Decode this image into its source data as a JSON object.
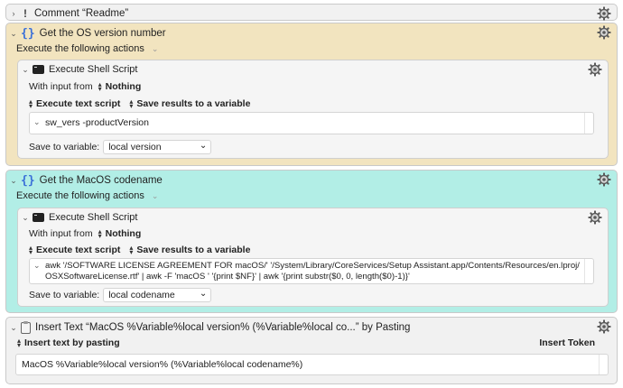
{
  "colors": {
    "accent_blue": "#3a6fd8",
    "yellow_group": "#f2e4bf",
    "teal_group": "#b2eee6"
  },
  "comment": {
    "title": "Comment “Readme”",
    "icon": "exclamation-icon",
    "disclosure": "›"
  },
  "group1": {
    "title": "Get the OS version number",
    "execute_label": "Execute the following actions",
    "action": {
      "title": "Execute Shell Script",
      "input_label": "With input from",
      "input_value": "Nothing",
      "execute_mode": "Execute text script",
      "result_mode": "Save results to a variable",
      "script": "sw_vers -productVersion",
      "save_label": "Save to variable:",
      "variable": "local version"
    }
  },
  "group2": {
    "title": "Get the MacOS codename",
    "execute_label": "Execute the following actions",
    "action": {
      "title": "Execute Shell Script",
      "input_label": "With input from",
      "input_value": "Nothing",
      "execute_mode": "Execute text script",
      "result_mode": "Save results to a variable",
      "script": "awk '/SOFTWARE LICENSE AGREEMENT FOR macOS/' '/System/Library/CoreServices/Setup Assistant.app/Contents/Resources/en.lproj/\nOSXSoftwareLicense.rtf' | awk -F 'macOS ' '{print $NF}' | awk '{print substr($0, 0, length($0)-1)}'",
      "save_label": "Save to variable:",
      "variable": "local codename"
    }
  },
  "insert": {
    "title": "Insert Text “MacOS %Variable%local version% (%Variable%local co...” by Pasting",
    "mode_label": "Insert text by pasting",
    "token_label": "Insert Token",
    "text": "MacOS %Variable%local version% (%Variable%local codename%)"
  }
}
